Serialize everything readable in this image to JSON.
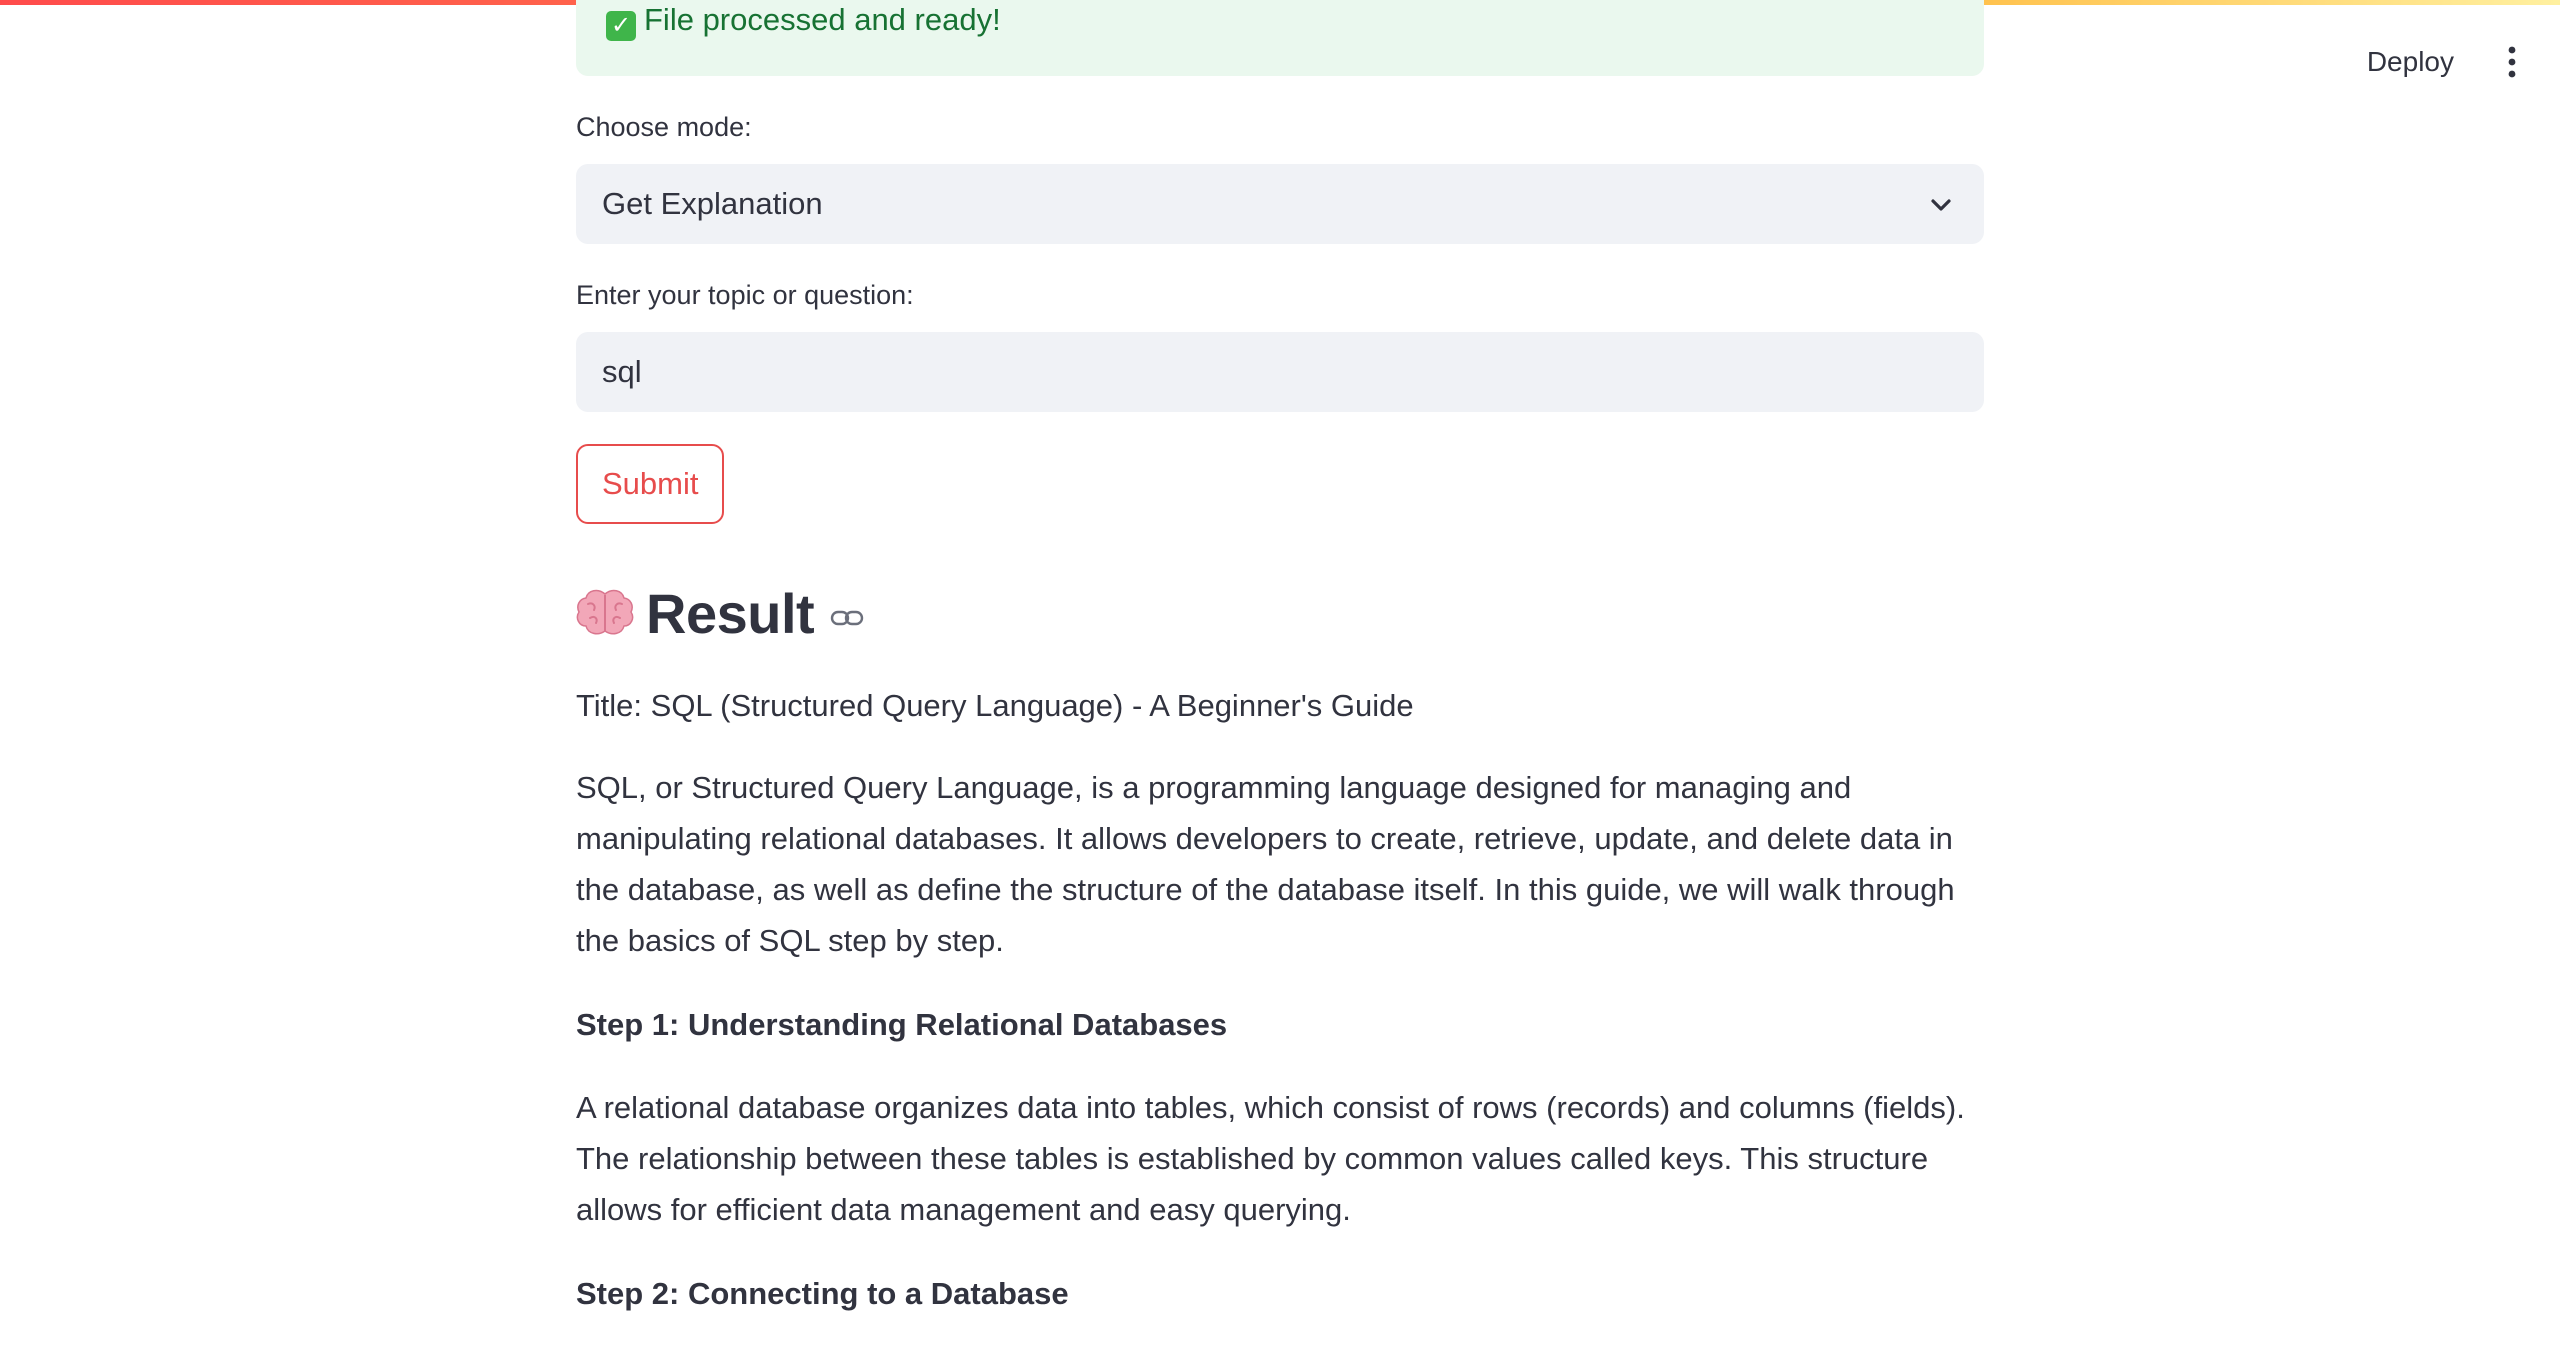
{
  "header": {
    "deploy_label": "Deploy",
    "menu_icon": "vertical-ellipsis-icon"
  },
  "alert": {
    "icon": "check-mark-icon",
    "text": "File processed and ready!"
  },
  "form": {
    "mode_label": "Choose mode:",
    "mode_value": "Get Explanation",
    "topic_label": "Enter your topic or question:",
    "topic_value": "sql",
    "submit_label": "Submit"
  },
  "result": {
    "heading": "Result",
    "heading_icon": "brain-icon",
    "anchor_icon": "link-icon",
    "title_line": "Title: SQL (Structured Query Language) - A Beginner's Guide",
    "intro": "SQL, or Structured Query Language, is a programming language designed for managing and manipulating relational databases. It allows developers to create, retrieve, update, and delete data in the database, as well as define the structure of the database itself. In this guide, we will walk through the basics of SQL step by step.",
    "step1_heading": "Step 1: Understanding Relational Databases",
    "step1_body": "A relational database organizes data into tables, which consist of rows (records) and columns (fields). The relationship between these tables is established by common values called keys. This structure allows for efficient data management and easy querying.",
    "step2_heading": "Step 2: Connecting to a Database"
  },
  "colors": {
    "accent": "#ff4b4b",
    "success_bg": "#eaf8ee",
    "success_text": "#177233",
    "input_bg": "#f0f2f6",
    "text": "#31333f"
  }
}
